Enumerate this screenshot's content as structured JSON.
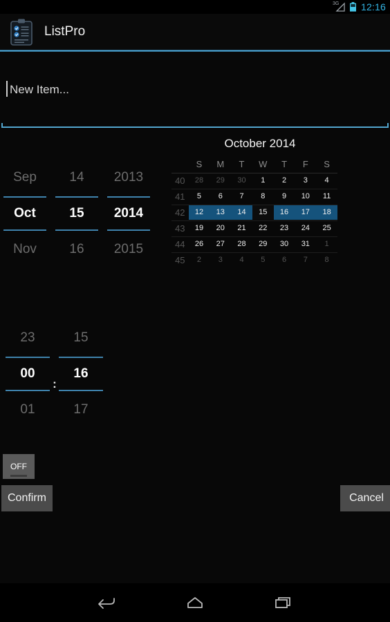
{
  "status_bar": {
    "network_label": "3G",
    "signal_icon": "signal-triangle-icon",
    "battery_icon": "battery-icon",
    "time": "12:16"
  },
  "title_bar": {
    "app_icon": "clipboard-list-icon",
    "app_name": "ListPro"
  },
  "new_item": {
    "placeholder": "New Item...",
    "value": "",
    "underline_color": "#53a6cf"
  },
  "date_picker": {
    "month": {
      "prev": "Sep",
      "current": "Oct",
      "next": "Nov"
    },
    "day": {
      "prev": "14",
      "current": "15",
      "next": "16"
    },
    "year": {
      "prev": "2013",
      "current": "2014",
      "next": "2015"
    }
  },
  "calendar": {
    "title": "October 2014",
    "day_headers": [
      "S",
      "M",
      "T",
      "W",
      "T",
      "F",
      "S"
    ],
    "week_numbers": [
      "40",
      "41",
      "42",
      "43",
      "44",
      "45"
    ],
    "weeks": [
      [
        {
          "d": "28",
          "adjacent": true
        },
        {
          "d": "29",
          "adjacent": true
        },
        {
          "d": "30",
          "adjacent": true
        },
        {
          "d": "1"
        },
        {
          "d": "2"
        },
        {
          "d": "3"
        },
        {
          "d": "4"
        }
      ],
      [
        {
          "d": "5"
        },
        {
          "d": "6"
        },
        {
          "d": "7"
        },
        {
          "d": "8"
        },
        {
          "d": "9"
        },
        {
          "d": "10"
        },
        {
          "d": "11"
        }
      ],
      [
        {
          "d": "12",
          "highlight": true
        },
        {
          "d": "13",
          "highlight": true
        },
        {
          "d": "14",
          "highlight": true
        },
        {
          "d": "15",
          "selected": true
        },
        {
          "d": "16",
          "highlight": true
        },
        {
          "d": "17",
          "highlight": true
        },
        {
          "d": "18",
          "highlight": true
        }
      ],
      [
        {
          "d": "19"
        },
        {
          "d": "20"
        },
        {
          "d": "21"
        },
        {
          "d": "22"
        },
        {
          "d": "23"
        },
        {
          "d": "24"
        },
        {
          "d": "25"
        }
      ],
      [
        {
          "d": "26"
        },
        {
          "d": "27"
        },
        {
          "d": "28"
        },
        {
          "d": "29"
        },
        {
          "d": "30"
        },
        {
          "d": "31"
        },
        {
          "d": "1",
          "adjacent": true
        }
      ],
      [
        {
          "d": "2",
          "adjacent": true
        },
        {
          "d": "3",
          "adjacent": true
        },
        {
          "d": "4",
          "adjacent": true
        },
        {
          "d": "5",
          "adjacent": true
        },
        {
          "d": "6",
          "adjacent": true
        },
        {
          "d": "7",
          "adjacent": true
        },
        {
          "d": "8",
          "adjacent": true
        }
      ]
    ],
    "highlight_color": "#15537c"
  },
  "time_picker": {
    "hour": {
      "prev": "23",
      "current": "00",
      "next": "01"
    },
    "separator": ":",
    "minute": {
      "prev": "15",
      "current": "16",
      "next": "17"
    }
  },
  "buttons": {
    "toggle_label": "OFF",
    "confirm_label": "Confirm",
    "cancel_label": "Cancel"
  },
  "nav_bar": {
    "back_icon": "back-arrow-icon",
    "home_icon": "home-icon",
    "recents_icon": "recent-apps-icon"
  },
  "theme": {
    "accent": "#33b5e5",
    "spinner_divider": "#3f83ad",
    "background": "#080808"
  }
}
